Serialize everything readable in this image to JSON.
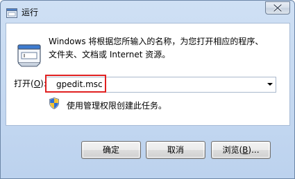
{
  "window": {
    "title": "运行"
  },
  "description": {
    "line1": "Windows 将根据您所输入的名称，为您打开相应的程序、",
    "line2": "文件夹、文档或 Internet 资源。"
  },
  "open": {
    "label_prefix": "打开(",
    "label_key": "O",
    "label_suffix": "):",
    "value": "gpedit.msc"
  },
  "admin_note": "使用管理权限创建此任务。",
  "buttons": {
    "ok": "确定",
    "cancel": "取消",
    "browse_prefix": "浏览(",
    "browse_key": "B",
    "browse_suffix": ")..."
  },
  "icons": {
    "title": "run-icon",
    "close": "close-icon",
    "run": "run-program-icon",
    "shield": "uac-shield-icon",
    "dropdown": "chevron-down-icon"
  },
  "colors": {
    "highlight_border": "#e02020",
    "titlebar": "#cfe0f4"
  }
}
